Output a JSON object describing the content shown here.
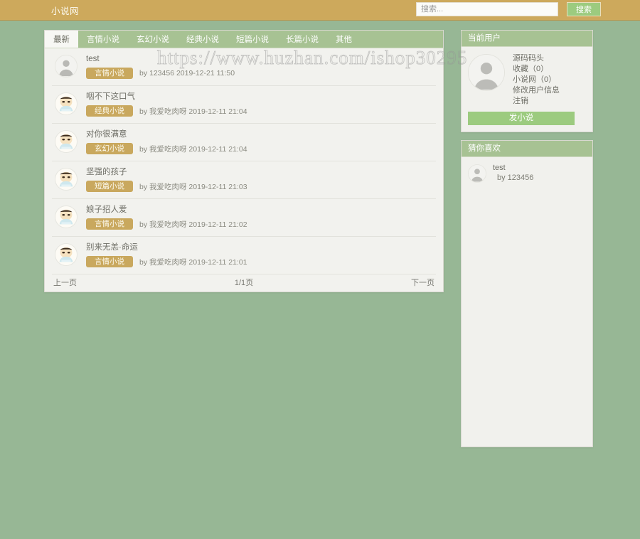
{
  "header": {
    "brand": "小说网",
    "search_placeholder": "搜索...",
    "search_value": "",
    "search_button": "搜索"
  },
  "tabs": [
    {
      "label": "最新",
      "active": true
    },
    {
      "label": "言情小说",
      "active": false
    },
    {
      "label": "玄幻小说",
      "active": false
    },
    {
      "label": "经典小说",
      "active": false
    },
    {
      "label": "短篇小说",
      "active": false
    },
    {
      "label": "长篇小说",
      "active": false
    },
    {
      "label": "其他",
      "active": false
    }
  ],
  "list": [
    {
      "title": "test",
      "tag": "言情小说",
      "byline": "by 123456 2019-12-21 11:50",
      "avatar": "default-user-avatar"
    },
    {
      "title": "咽不下这口气",
      "tag": "经典小说",
      "byline": "by 我爱吃肉呀 2019-12-11 21:04",
      "avatar": "cartoon-avatar"
    },
    {
      "title": "对你很满意",
      "tag": "玄幻小说",
      "byline": "by 我爱吃肉呀 2019-12-11 21:04",
      "avatar": "cartoon-avatar"
    },
    {
      "title": "坚强的孩子",
      "tag": "短篇小说",
      "byline": "by 我爱吃肉呀 2019-12-11 21:03",
      "avatar": "cartoon-avatar"
    },
    {
      "title": "娘子招人爱",
      "tag": "言情小说",
      "byline": "by 我爱吃肉呀 2019-12-11 21:02",
      "avatar": "cartoon-avatar"
    },
    {
      "title": "别来无恙·命运",
      "tag": "言情小说",
      "byline": "by 我爱吃肉呀 2019-12-11 21:01",
      "avatar": "cartoon-avatar"
    }
  ],
  "pager": {
    "prev": "上一页",
    "current": "1/1页",
    "next": "下一页"
  },
  "sidebar": {
    "user_panel": {
      "title": "当前用户",
      "username": "源码码头",
      "links": [
        "收藏（0）",
        "小说网（0）",
        "修改用户信息",
        "注销"
      ],
      "post_button": "发小说"
    },
    "like_panel": {
      "title": "猜你喜欢",
      "items": [
        {
          "title": "test",
          "by": "by 123456"
        }
      ]
    }
  },
  "watermark": "https://www.huzhan.com/ishop30295",
  "colors": {
    "page_background": "#97b795",
    "topbar": "#cda95c",
    "panel_head": "#a7c293",
    "accent_green": "#9ccb7f",
    "tag_gold": "#c9a85e",
    "card_background": "#f2f2ee"
  }
}
